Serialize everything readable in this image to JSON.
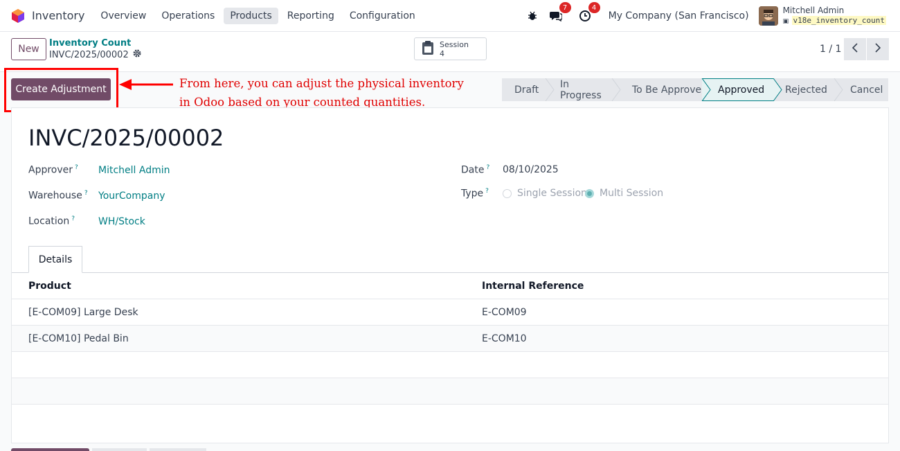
{
  "nav": {
    "app_name": "Inventory",
    "menu": [
      "Overview",
      "Operations",
      "Products",
      "Reporting",
      "Configuration"
    ],
    "active_menu": "Products",
    "messages_count": "7",
    "activities_count": "4",
    "company": "My Company (San Francisco)",
    "user_name": "Mitchell Admin",
    "database": "v18e_inventory_count"
  },
  "control": {
    "new_label": "New",
    "breadcrumb_parent": "Inventory Count",
    "breadcrumb_current": "INVC/2025/00002",
    "session_label": "Session",
    "session_count": "4",
    "pager": "1 / 1"
  },
  "actions": {
    "create_adjustment": "Create Adjustment"
  },
  "annotation": {
    "line1": "From here, you can adjust the physical inventory",
    "line2": "in Odoo based on your counted quantities."
  },
  "statusbar": {
    "stages": [
      "Draft",
      "In Progress",
      "To Be Approve",
      "Approved",
      "Rejected",
      "Cancel"
    ],
    "active": "Approved"
  },
  "form": {
    "title": "INVC/2025/00002",
    "approver_label": "Approver",
    "approver": "Mitchell Admin",
    "warehouse_label": "Warehouse",
    "warehouse": "YourCompany",
    "location_label": "Location",
    "location": "WH/Stock",
    "date_label": "Date",
    "date": "08/10/2025",
    "type_label": "Type",
    "type_options": [
      "Single Session",
      "Multi Session"
    ],
    "type_selected": "Multi Session",
    "help_mark": "?"
  },
  "tabs": {
    "details": "Details"
  },
  "table": {
    "columns": [
      "Product",
      "Internal Reference"
    ],
    "rows": [
      {
        "product": "[E-COM09] Large Desk",
        "ref": "E-COM09"
      },
      {
        "product": "[E-COM10] Pedal Bin",
        "ref": "E-COM10"
      }
    ]
  },
  "colors": {
    "primary": "#714b67",
    "link": "#017e84",
    "annotation": "#e00000"
  }
}
